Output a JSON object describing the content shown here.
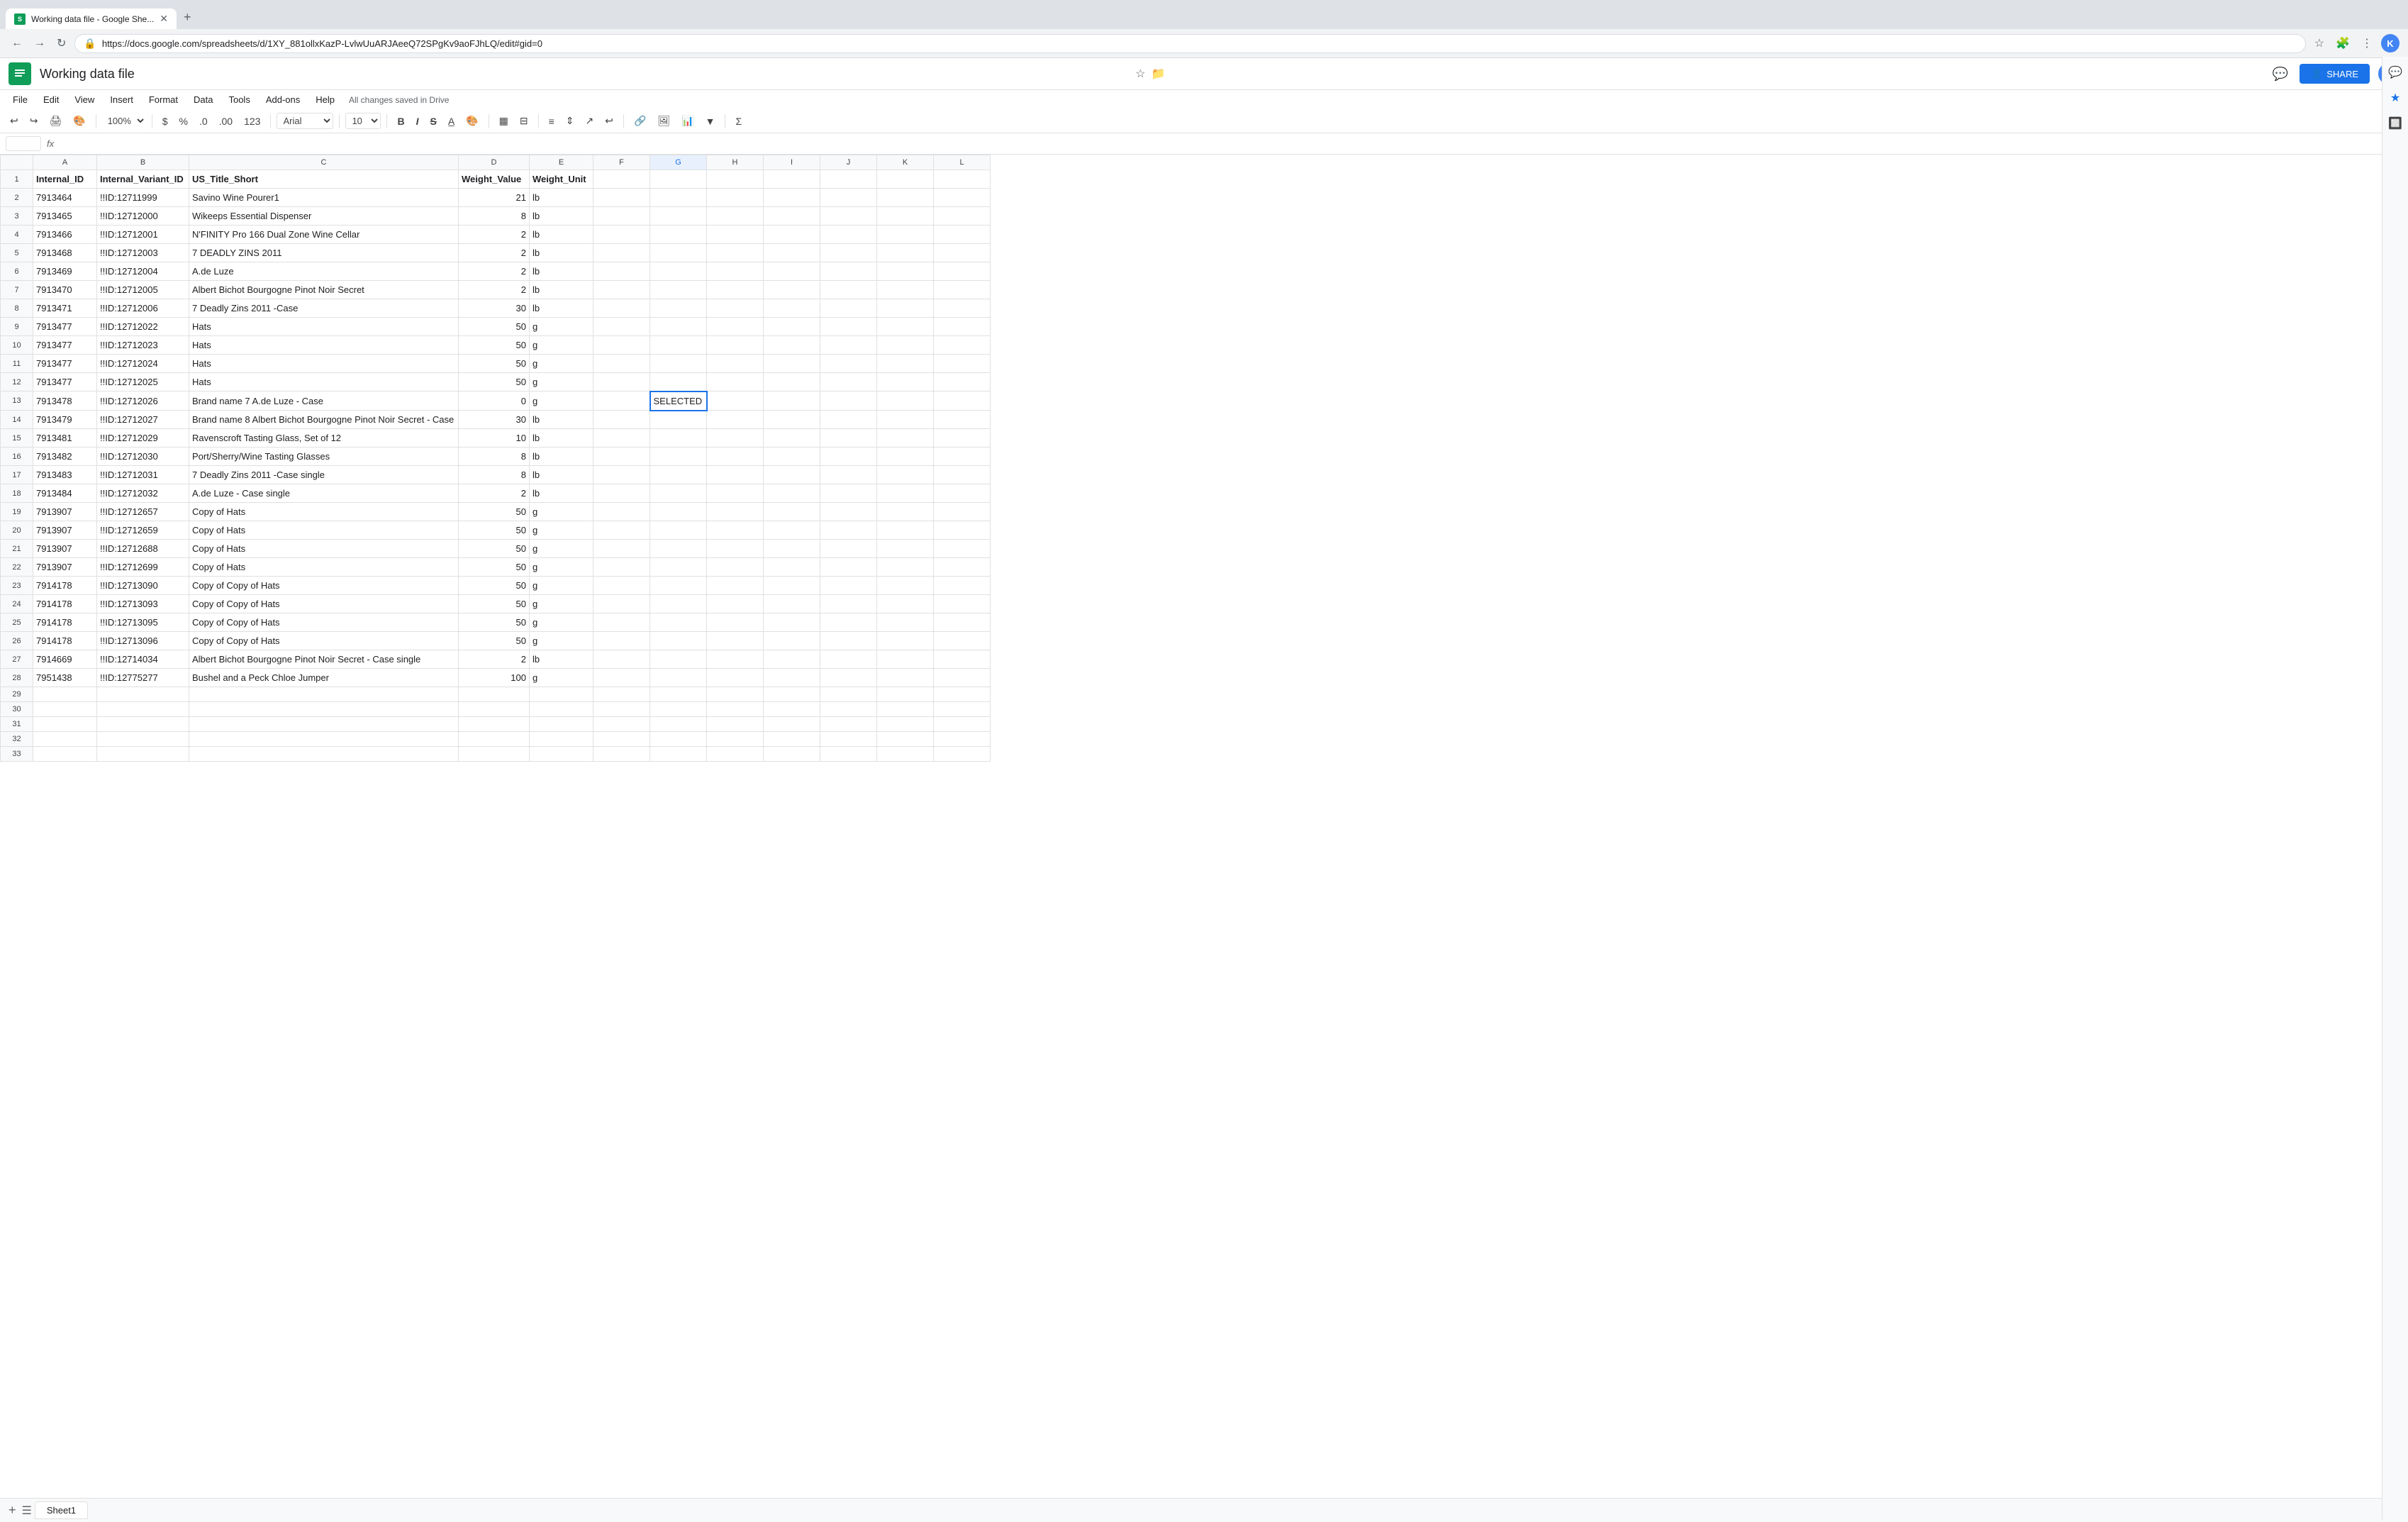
{
  "browser": {
    "tab_title": "Working data file - Google She...",
    "url": "https://docs.google.com/spreadsheets/d/1XY_881ollxKazP-LvlwUuARJAeeQ72SPgKv9aoFJhLQ/edit#gid=0",
    "new_tab_label": "+",
    "user_initial": "K"
  },
  "app": {
    "logo_text": "S",
    "title": "Working data file",
    "saved_text": "All changes saved in Drive",
    "share_label": "SHARE",
    "user_initial": "K"
  },
  "menu": {
    "items": [
      "File",
      "Edit",
      "View",
      "Insert",
      "Format",
      "Data",
      "Tools",
      "Add-ons",
      "Help"
    ]
  },
  "toolbar": {
    "zoom": "100%",
    "font": "Arial",
    "font_size": "10",
    "undo_label": "↩",
    "redo_label": "↪"
  },
  "formula_bar": {
    "cell_ref": "",
    "fx": "fx"
  },
  "columns": {
    "headers": [
      "",
      "A",
      "B",
      "C",
      "D",
      "E",
      "F",
      "G",
      "H",
      "I",
      "J",
      "K",
      "L"
    ]
  },
  "sheet": {
    "name": "Sheet1"
  },
  "rows": [
    {
      "row": 1,
      "a": "Internal_ID",
      "b": "Internal_Variant_ID",
      "c": "US_Title_Short",
      "d": "Weight_Value",
      "e": "Weight_Unit",
      "f": "",
      "g": "",
      "h": "",
      "i": "",
      "j": "",
      "k": "",
      "l": "",
      "is_header": true
    },
    {
      "row": 2,
      "a": "7913464",
      "b": "!!ID:12711999",
      "c": "Savino Wine Pourer1",
      "d": "21",
      "e": "lb",
      "f": "",
      "g": "",
      "h": "",
      "i": "",
      "j": "",
      "k": "",
      "l": ""
    },
    {
      "row": 3,
      "a": "7913465",
      "b": "!!ID:12712000",
      "c": "Wikeeps Essential Dispenser",
      "d": "8",
      "e": "lb",
      "f": "",
      "g": "",
      "h": "",
      "i": "",
      "j": "",
      "k": "",
      "l": ""
    },
    {
      "row": 4,
      "a": "7913466",
      "b": "!!ID:12712001",
      "c": "N'FINITY Pro 166 Dual Zone Wine Cellar",
      "d": "2",
      "e": "lb",
      "f": "",
      "g": "",
      "h": "",
      "i": "",
      "j": "",
      "k": "",
      "l": ""
    },
    {
      "row": 5,
      "a": "7913468",
      "b": "!!ID:12712003",
      "c": "7 DEADLY ZINS 2011",
      "d": "2",
      "e": "lb",
      "f": "",
      "g": "",
      "h": "",
      "i": "",
      "j": "",
      "k": "",
      "l": ""
    },
    {
      "row": 6,
      "a": "7913469",
      "b": "!!ID:12712004",
      "c": "A.de Luze",
      "d": "2",
      "e": "lb",
      "f": "",
      "g": "",
      "h": "",
      "i": "",
      "j": "",
      "k": "",
      "l": ""
    },
    {
      "row": 7,
      "a": "7913470",
      "b": "!!ID:12712005",
      "c": "Albert Bichot Bourgogne Pinot Noir Secret",
      "d": "2",
      "e": "lb",
      "f": "",
      "g": "",
      "h": "",
      "i": "",
      "j": "",
      "k": "",
      "l": ""
    },
    {
      "row": 8,
      "a": "7913471",
      "b": "!!ID:12712006",
      "c": "7 Deadly Zins 2011 -Case",
      "d": "30",
      "e": "lb",
      "f": "",
      "g": "",
      "h": "",
      "i": "",
      "j": "",
      "k": "",
      "l": ""
    },
    {
      "row": 9,
      "a": "7913477",
      "b": "!!ID:12712022",
      "c": "Hats",
      "d": "50",
      "e": "g",
      "f": "",
      "g": "",
      "h": "",
      "i": "",
      "j": "",
      "k": "",
      "l": ""
    },
    {
      "row": 10,
      "a": "7913477",
      "b": "!!ID:12712023",
      "c": "Hats",
      "d": "50",
      "e": "g",
      "f": "",
      "g": "",
      "h": "",
      "i": "",
      "j": "",
      "k": "",
      "l": ""
    },
    {
      "row": 11,
      "a": "7913477",
      "b": "!!ID:12712024",
      "c": "Hats",
      "d": "50",
      "e": "g",
      "f": "",
      "g": "",
      "h": "",
      "i": "",
      "j": "",
      "k": "",
      "l": ""
    },
    {
      "row": 12,
      "a": "7913477",
      "b": "!!ID:12712025",
      "c": "Hats",
      "d": "50",
      "e": "g",
      "f": "",
      "g": "",
      "h": "",
      "i": "",
      "j": "",
      "k": "",
      "l": ""
    },
    {
      "row": 13,
      "a": "7913478",
      "b": "!!ID:12712026",
      "c": "Brand name 7 A.de Luze - Case",
      "d": "0",
      "e": "g",
      "f": "",
      "g": "SELECTED",
      "h": "",
      "i": "",
      "j": "",
      "k": "",
      "l": ""
    },
    {
      "row": 14,
      "a": "7913479",
      "b": "!!ID:12712027",
      "c": "Brand name 8 Albert Bichot Bourgogne Pinot Noir Secret - Case",
      "d": "30",
      "e": "lb",
      "f": "",
      "g": "",
      "h": "",
      "i": "",
      "j": "",
      "k": "",
      "l": ""
    },
    {
      "row": 15,
      "a": "7913481",
      "b": "!!ID:12712029",
      "c": "Ravenscroft Tasting Glass, Set of 12",
      "d": "10",
      "e": "lb",
      "f": "",
      "g": "",
      "h": "",
      "i": "",
      "j": "",
      "k": "",
      "l": ""
    },
    {
      "row": 16,
      "a": "7913482",
      "b": "!!ID:12712030",
      "c": "Port/Sherry/Wine Tasting Glasses",
      "d": "8",
      "e": "lb",
      "f": "",
      "g": "",
      "h": "",
      "i": "",
      "j": "",
      "k": "",
      "l": ""
    },
    {
      "row": 17,
      "a": "7913483",
      "b": "!!ID:12712031",
      "c": "7 Deadly Zins 2011 -Case single",
      "d": "8",
      "e": "lb",
      "f": "",
      "g": "",
      "h": "",
      "i": "",
      "j": "",
      "k": "",
      "l": ""
    },
    {
      "row": 18,
      "a": "7913484",
      "b": "!!ID:12712032",
      "c": "A.de Luze - Case single",
      "d": "2",
      "e": "lb",
      "f": "",
      "g": "",
      "h": "",
      "i": "",
      "j": "",
      "k": "",
      "l": ""
    },
    {
      "row": 19,
      "a": "7913907",
      "b": "!!ID:12712657",
      "c": "Copy of Hats",
      "d": "50",
      "e": "g",
      "f": "",
      "g": "",
      "h": "",
      "i": "",
      "j": "",
      "k": "",
      "l": ""
    },
    {
      "row": 20,
      "a": "7913907",
      "b": "!!ID:12712659",
      "c": "Copy of Hats",
      "d": "50",
      "e": "g",
      "f": "",
      "g": "",
      "h": "",
      "i": "",
      "j": "",
      "k": "",
      "l": ""
    },
    {
      "row": 21,
      "a": "7913907",
      "b": "!!ID:12712688",
      "c": "Copy of Hats",
      "d": "50",
      "e": "g",
      "f": "",
      "g": "",
      "h": "",
      "i": "",
      "j": "",
      "k": "",
      "l": ""
    },
    {
      "row": 22,
      "a": "7913907",
      "b": "!!ID:12712699",
      "c": "Copy of Hats",
      "d": "50",
      "e": "g",
      "f": "",
      "g": "",
      "h": "",
      "i": "",
      "j": "",
      "k": "",
      "l": ""
    },
    {
      "row": 23,
      "a": "7914178",
      "b": "!!ID:12713090",
      "c": "Copy of Copy of Hats",
      "d": "50",
      "e": "g",
      "f": "",
      "g": "",
      "h": "",
      "i": "",
      "j": "",
      "k": "",
      "l": ""
    },
    {
      "row": 24,
      "a": "7914178",
      "b": "!!ID:12713093",
      "c": "Copy of Copy of Hats",
      "d": "50",
      "e": "g",
      "f": "",
      "g": "",
      "h": "",
      "i": "",
      "j": "",
      "k": "",
      "l": ""
    },
    {
      "row": 25,
      "a": "7914178",
      "b": "!!ID:12713095",
      "c": "Copy of Copy of Hats",
      "d": "50",
      "e": "g",
      "f": "",
      "g": "",
      "h": "",
      "i": "",
      "j": "",
      "k": "",
      "l": ""
    },
    {
      "row": 26,
      "a": "7914178",
      "b": "!!ID:12713096",
      "c": "Copy of Copy of Hats",
      "d": "50",
      "e": "g",
      "f": "",
      "g": "",
      "h": "",
      "i": "",
      "j": "",
      "k": "",
      "l": ""
    },
    {
      "row": 27,
      "a": "7914669",
      "b": "!!ID:12714034",
      "c": "Albert Bichot Bourgogne Pinot Noir Secret - Case single",
      "d": "2",
      "e": "lb",
      "f": "",
      "g": "",
      "h": "",
      "i": "",
      "j": "",
      "k": "",
      "l": ""
    },
    {
      "row": 28,
      "a": "7951438",
      "b": "!!ID:12775277",
      "c": "Bushel and a Peck Chloe Jumper",
      "d": "100",
      "e": "g",
      "f": "",
      "g": "",
      "h": "",
      "i": "",
      "j": "",
      "k": "",
      "l": ""
    },
    {
      "row": 29,
      "a": "",
      "b": "",
      "c": "",
      "d": "",
      "e": "",
      "f": "",
      "g": "",
      "h": "",
      "i": "",
      "j": "",
      "k": "",
      "l": ""
    },
    {
      "row": 30,
      "a": "",
      "b": "",
      "c": "",
      "d": "",
      "e": "",
      "f": "",
      "g": "",
      "h": "",
      "i": "",
      "j": "",
      "k": "",
      "l": ""
    },
    {
      "row": 31,
      "a": "",
      "b": "",
      "c": "",
      "d": "",
      "e": "",
      "f": "",
      "g": "",
      "h": "",
      "i": "",
      "j": "",
      "k": "",
      "l": ""
    },
    {
      "row": 32,
      "a": "",
      "b": "",
      "c": "",
      "d": "",
      "e": "",
      "f": "",
      "g": "",
      "h": "",
      "i": "",
      "j": "",
      "k": "",
      "l": ""
    },
    {
      "row": 33,
      "a": "",
      "b": "",
      "c": "",
      "d": "",
      "e": "",
      "f": "",
      "g": "",
      "h": "",
      "i": "",
      "j": "",
      "k": "",
      "l": ""
    }
  ]
}
